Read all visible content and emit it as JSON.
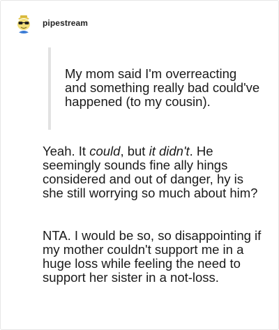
{
  "post": {
    "username": "pipestream",
    "avatar_icon": "frog-with-sunglasses-avatar",
    "quote": "My mom said I'm overreacting and something really bad could've happened (to my cousin).",
    "reply": {
      "p1_before": "Yeah. It ",
      "p1_em1": "could",
      "p1_mid": ", but ",
      "p1_em2": "it didn't",
      "p1_after": ". He seemingly sounds fine ally hings considered and out of danger, hy is she still worrying so much about him?",
      "p2": "NTA. I would be so, so disappointing if my mother couldn't support me in a huge loss while feeling the need to support her sister in a not-loss."
    }
  },
  "colors": {
    "quote_bar": "#e2e2e2",
    "text": "#1a1a1a",
    "frame_border": "#e6e6e6"
  }
}
